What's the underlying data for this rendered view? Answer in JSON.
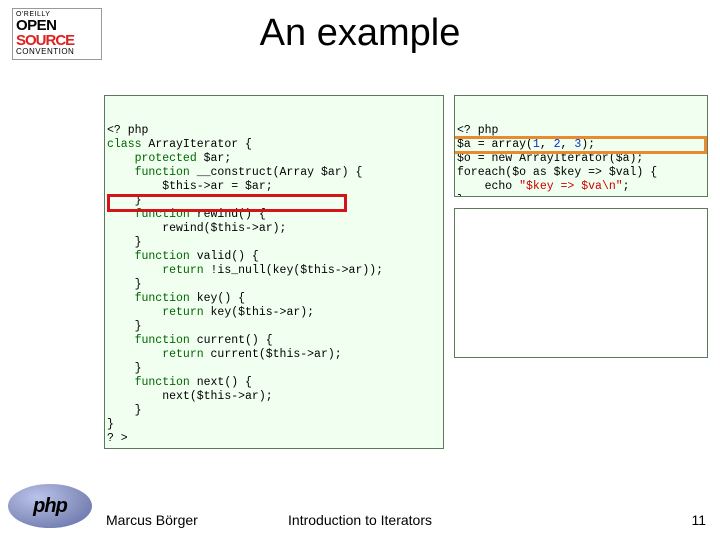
{
  "logo": {
    "line1": "O'REILLY",
    "line2": "OPEN",
    "line3": "SOURCE",
    "line4": "CONVENTION"
  },
  "phpLogo": "php",
  "title": "An example",
  "leftCode": {
    "l01a": "<? ",
    "l01b": "php",
    "l02a": "class ",
    "l02b": "ArrayIterator {",
    "l03a": "    protected ",
    "l03b": "$ar;",
    "l04a": "    function ",
    "l04b": "__construct(Array $ar) {",
    "l05": "        $this->ar = $ar;",
    "l06": "    }",
    "l07a": "    function ",
    "l07b": "rewind() {",
    "l08": "        rewind($this->ar);",
    "l09": "    }",
    "l10a": "    function ",
    "l10b": "valid() {",
    "l11a": "        return ",
    "l11b": "!is_null(key($this->ar));",
    "l12": "    }",
    "l13a": "    function ",
    "l13b": "key() {",
    "l14a": "        return ",
    "l14b": "key($this->ar);",
    "l15": "    }",
    "l16a": "    function ",
    "l16b": "current() {",
    "l17a": "        return ",
    "l17b": "current($this->ar);",
    "l18": "    }",
    "l19a": "    function ",
    "l19b": "next() {",
    "l20": "        next($this->ar);",
    "l21": "    }",
    "l22": "}",
    "l23": "? >"
  },
  "rightCode": {
    "l01a": "<? ",
    "l01b": "php",
    "l02a": "$a = array(",
    "l02b": "1",
    "l02c": ", ",
    "l02d": "2",
    "l02e": ", ",
    "l02f": "3",
    "l02g": ");",
    "l03": "$o = new ArrayIterator($a);",
    "l04": "foreach($o as $key => $val) {",
    "l05a": "    echo ",
    "l05b": "\"$key => $va\\n\"",
    "l05c": ";",
    "l06": "}",
    "l07": "? >"
  },
  "footer": {
    "author": "Marcus Börger",
    "center": "Introduction to Iterators",
    "page": "11"
  }
}
